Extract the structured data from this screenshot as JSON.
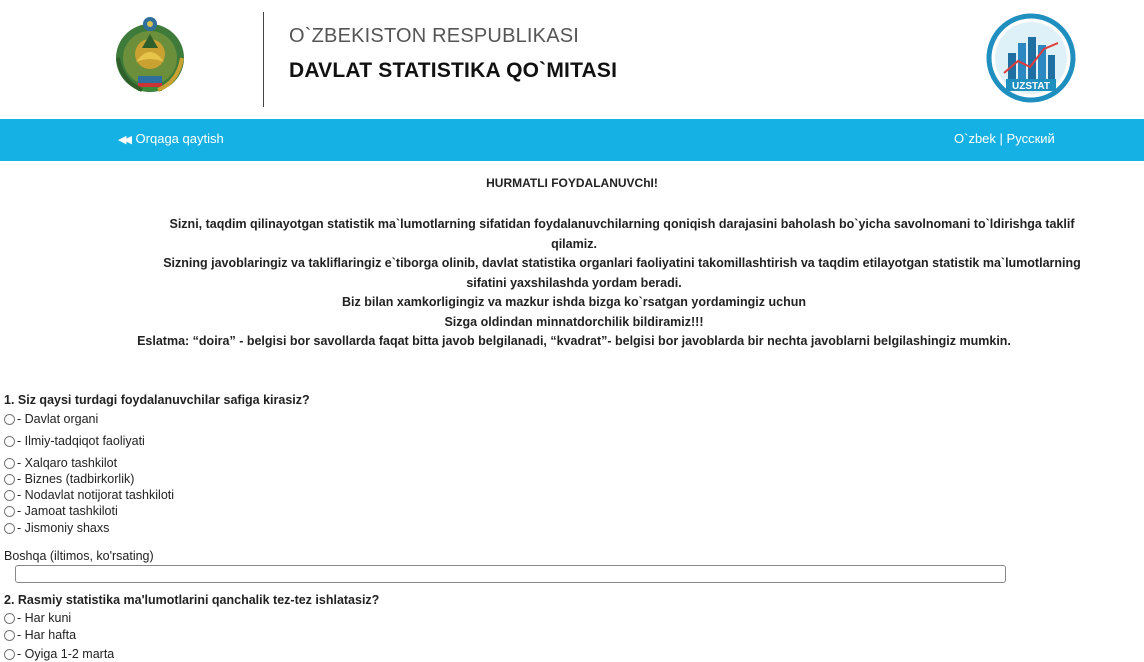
{
  "header": {
    "org_line1": "O`ZBEKISTON RESPUBLIKASI",
    "org_line2": "DAVLAT STATISTIKA QO`MITASI",
    "logo_text": "UZSTAT"
  },
  "nav": {
    "back_label": "Orqaga qaytish",
    "lang_uz": "O`zbek",
    "lang_sep": "|",
    "lang_ru": "Русский"
  },
  "intro": {
    "greeting": "HURMATLI FOYDALANUVChI!",
    "lines": [
      "Sizni, taqdim qilinayotgan statistik ma`lumotlarning sifatidan foydalanuvchilarning qoniqish darajasini baholash bo`yicha savolnomani to`ldirishga taklif",
      "qilamiz.",
      "Sizning javoblaringiz va takliflaringiz e`tiborga olinib, davlat statistika organlari faoliyatini takomillashtirish va taqdim etilayotgan statistik ma`lumotlarning",
      "sifatini yaxshilashda yordam beradi.",
      "Biz bilan xamkorligingiz va mazkur ishda bizga ko`rsatgan yordamingiz uchun",
      "Sizga oldindan minnatdorchilik bildiramiz!!!",
      "Eslatma: “doira” - belgisi bor savollarda faqat bitta javob belgilanadi, “kvadrat”- belgisi bor javoblarda bir nechta javoblarni belgilashingiz mumkin."
    ]
  },
  "q1": {
    "title": "1. Siz qaysi turdagi foydalanuvchilar safiga kirasiz?",
    "options": [
      "- Davlat organi",
      "- Ilmiy-tadqiqot faoliyati",
      " - Xalqaro tashkilot",
      " - Biznes (tadbirkorlik)",
      " - Nodavlat notijorat tashkiloti",
      " - Jamoat tashkiloti",
      " - Jismoniy shaxs"
    ],
    "other_label": "Boshqa (iltimos, ko'rsating)",
    "other_value": ""
  },
  "q2": {
    "title": "2. Rasmiy statistika ma'lumotlarini qanchalik tez-tez ishlatasiz?",
    "options": [
      " - Har kuni",
      " - Har hafta",
      " - Oyiga 1-2 marta"
    ]
  },
  "colors": {
    "navbar": "#16b1e4",
    "logo_circle": "#1f8fbf"
  }
}
